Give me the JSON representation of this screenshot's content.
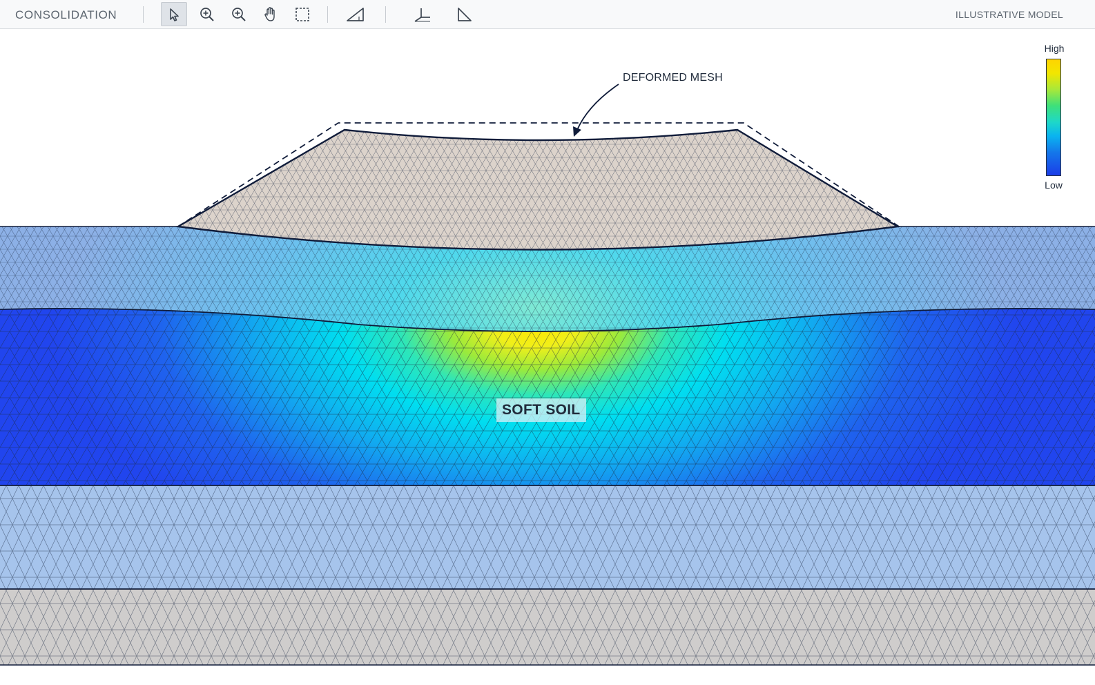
{
  "app": {
    "title": "CONSOLIDATION",
    "mode_label": "ILLUSTRATIVE MODEL"
  },
  "toolbar": {
    "tools": [
      {
        "name": "select-tool",
        "icon": "cursor-arrow-icon",
        "active": true
      },
      {
        "name": "zoom-in-tool",
        "icon": "zoom-in-icon",
        "active": false
      },
      {
        "name": "zoom-window-tool",
        "icon": "zoom-window-icon",
        "active": false
      },
      {
        "name": "pan-tool",
        "icon": "hand-icon",
        "active": false
      },
      {
        "name": "selection-box-tool",
        "icon": "dashed-rectangle-icon",
        "active": false
      },
      {
        "name": "draw-polygon-tool",
        "icon": "triangle-outline-icon",
        "active": false
      },
      {
        "name": "axes-tool",
        "icon": "axes-icon",
        "active": false
      },
      {
        "name": "right-triangle-tool",
        "icon": "right-triangle-icon",
        "active": false
      }
    ]
  },
  "legend": {
    "high_label": "High",
    "low_label": "Low",
    "colors": [
      "#ffd400",
      "#f2e600",
      "#a8e83a",
      "#3ee07a",
      "#1ed8c8",
      "#0ab4f0",
      "#1478ea",
      "#1b3de8"
    ]
  },
  "model": {
    "annotation": "DEFORMED MESH",
    "soil_label": "SOFT SOIL",
    "layer_colors": {
      "embankment": "#dcd3cb",
      "upper_layer": "#8cb2e8",
      "soft_soil": "#1f4ef0",
      "lower_layer": "#a6c4ec",
      "base_layer": "#cfcdcc",
      "mesh_line": "#1c2a44",
      "boundary": "#101c3a"
    }
  }
}
